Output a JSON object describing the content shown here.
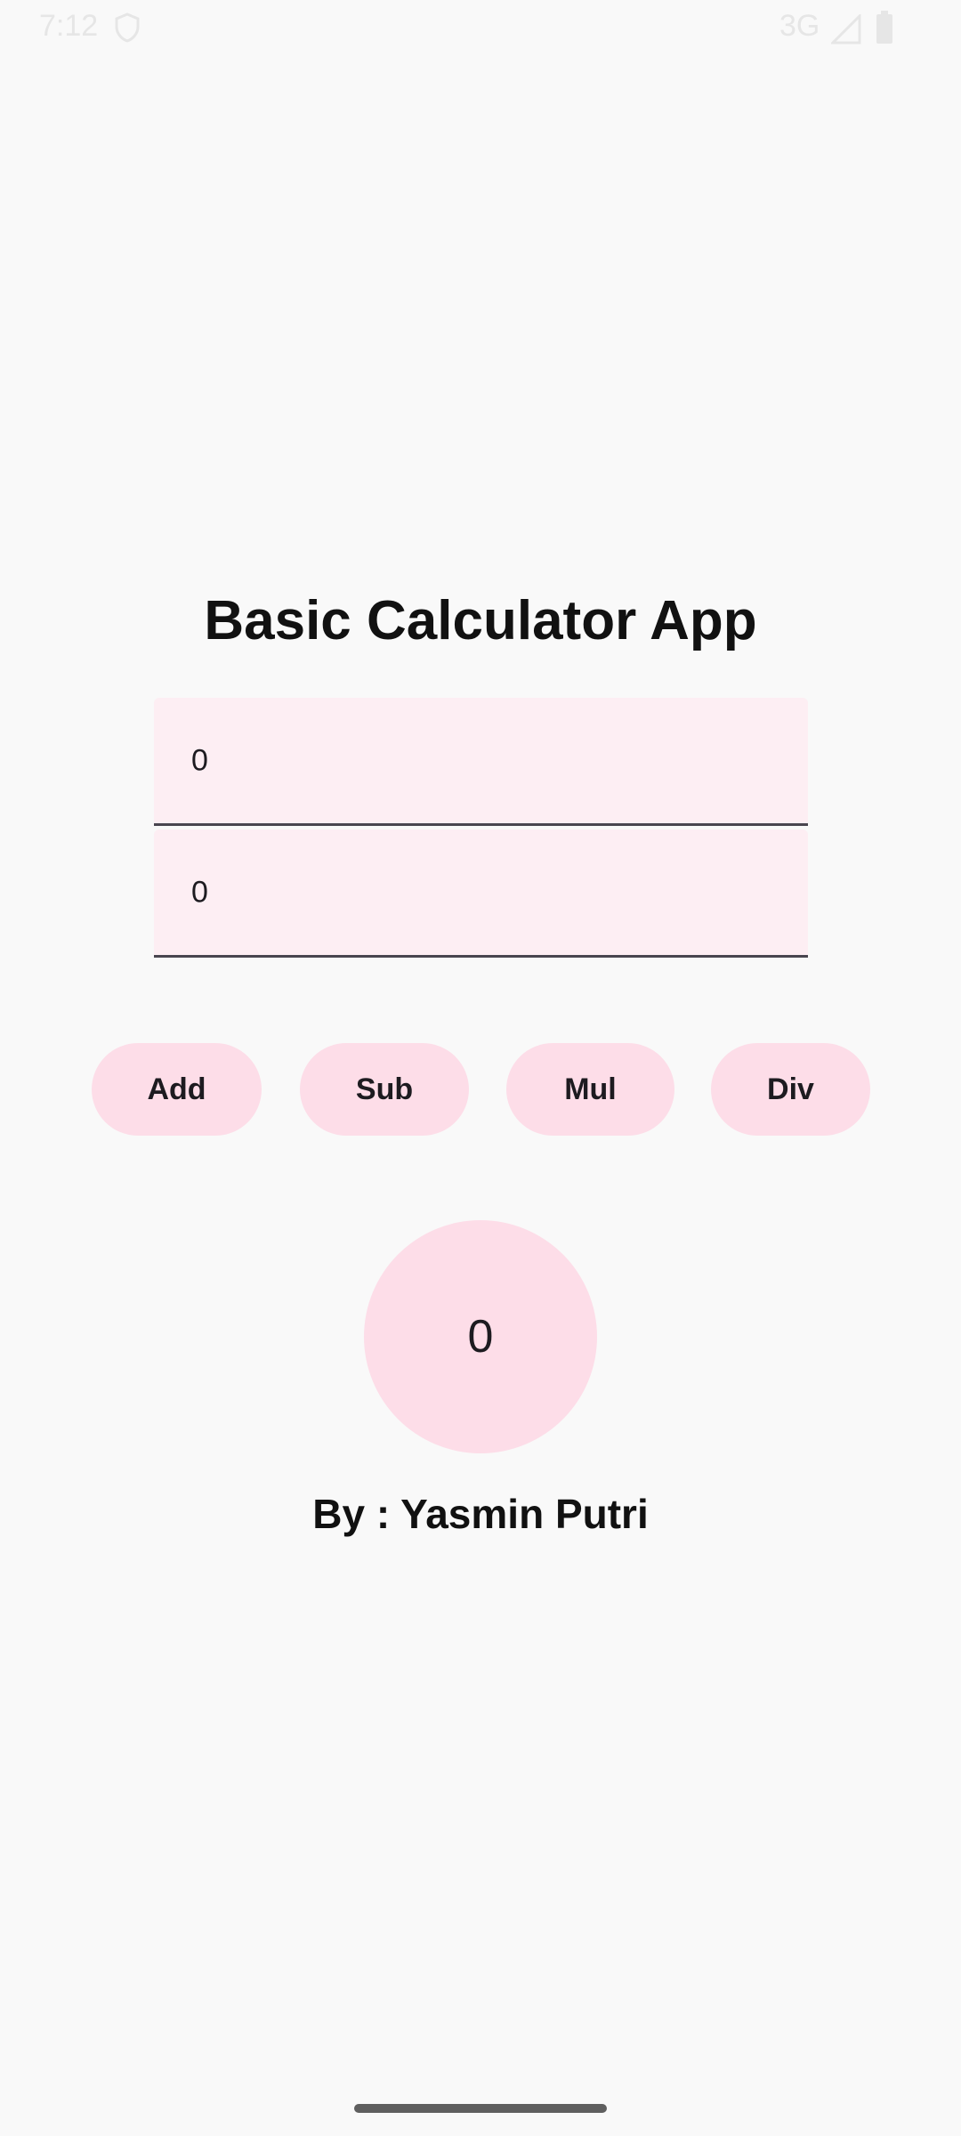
{
  "status_bar": {
    "time": "7:12",
    "network": "3G",
    "icons": [
      "shield-icon",
      "signal-icon",
      "battery-icon"
    ]
  },
  "app": {
    "title": "Basic Calculator App",
    "author": "By : Yasmin Putri"
  },
  "inputs": {
    "first_value": "0",
    "second_value": "0"
  },
  "operations": {
    "add_label": "Add",
    "sub_label": "Sub",
    "mul_label": "Mul",
    "div_label": "Div"
  },
  "result": {
    "value": "0"
  },
  "colors": {
    "background": "#f9f9f9",
    "field_background": "#fdeef3",
    "button_background": "#fddde8",
    "underline": "#49454f",
    "text": "#1d1b20"
  }
}
